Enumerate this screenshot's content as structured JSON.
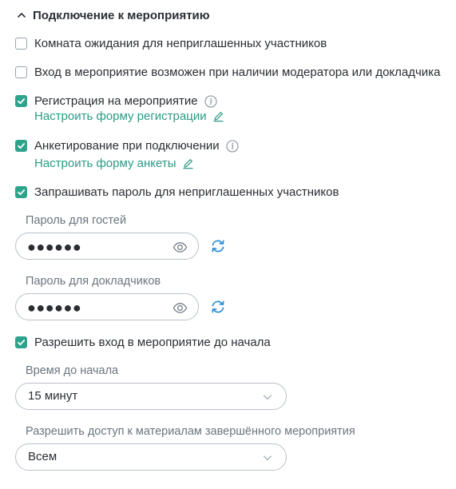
{
  "section": {
    "title": "Подключение к мероприятию",
    "expanded": true
  },
  "options": {
    "waiting_room": {
      "label": "Комната ожидания для неприглашенных участников",
      "checked": false
    },
    "moderator_required": {
      "label": "Вход в мероприятие возможен при наличии модератора или докладчика",
      "checked": false
    },
    "registration": {
      "label": "Регистрация на мероприятие",
      "checked": true,
      "link": "Настроить форму регистрации"
    },
    "survey": {
      "label": "Анкетирование при подключении",
      "checked": true,
      "link": "Настроить форму анкеты"
    },
    "password_required": {
      "label": "Запрашивать пароль для неприглашенных участников",
      "checked": true
    },
    "early_entry": {
      "label": "Разрешить вход в мероприятие до начала",
      "checked": true
    }
  },
  "guest_password": {
    "label": "Пароль для гостей",
    "masked": "●●●●●●"
  },
  "speaker_password": {
    "label": "Пароль для докладчиков",
    "masked": "●●●●●●"
  },
  "time_before_start": {
    "label": "Время до начала",
    "value": "15 минут"
  },
  "materials_access": {
    "label": "Разрешить доступ к материалам завершённого мероприятия",
    "value": "Всем"
  },
  "colors": {
    "accent": "#2ea38c",
    "link": "#2a9a84",
    "text": "#2a2e33",
    "muted": "#6b747e",
    "border": "#b9c1c9",
    "refresh": "#2b8fd6"
  },
  "icons": [
    "chevron-up-icon",
    "check-icon",
    "info-icon",
    "pencil-icon",
    "eye-icon",
    "refresh-icon",
    "chevron-down-icon"
  ]
}
